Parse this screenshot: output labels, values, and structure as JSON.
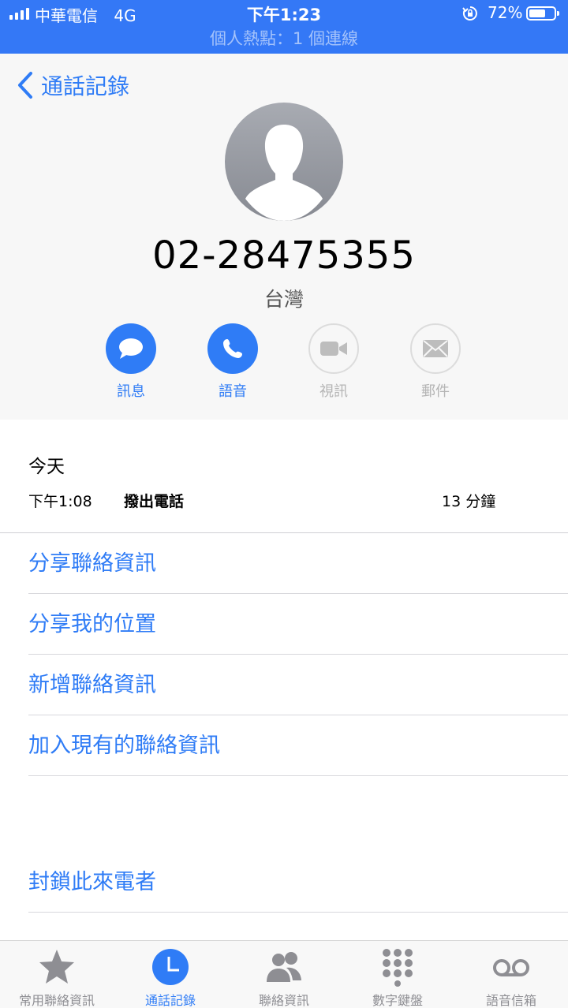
{
  "status_bar": {
    "carrier": "中華電信",
    "network": "4G",
    "time": "下午1:23",
    "battery_percent": "72%",
    "battery_level": 0.72,
    "hotspot": "個人熱點：1 個連線"
  },
  "nav": {
    "back_label": "通話記錄"
  },
  "contact": {
    "number": "02-28475355",
    "location": "台灣"
  },
  "actions": [
    {
      "label": "訊息",
      "enabled": true
    },
    {
      "label": "語音",
      "enabled": true
    },
    {
      "label": "視訊",
      "enabled": false
    },
    {
      "label": "郵件",
      "enabled": false
    }
  ],
  "history": {
    "day": "今天",
    "time": "下午1:08",
    "type": "撥出電話",
    "duration": "13 分鐘"
  },
  "menu": [
    "分享聯絡資訊",
    "分享我的位置",
    "新增聯絡資訊",
    "加入現有的聯絡資訊"
  ],
  "block_caller": "封鎖此來電者",
  "tabs": [
    {
      "label": "常用聯絡資訊",
      "icon": "star-icon"
    },
    {
      "label": "通話記錄",
      "icon": "clock-icon",
      "active": true
    },
    {
      "label": "聯絡資訊",
      "icon": "contacts-icon"
    },
    {
      "label": "數字鍵盤",
      "icon": "keypad-icon"
    },
    {
      "label": "語音信箱",
      "icon": "voicemail-icon"
    }
  ],
  "colors": {
    "accent": "#2f7cf6",
    "status_bar": "#3478f6",
    "inactive": "#8e8e93"
  }
}
